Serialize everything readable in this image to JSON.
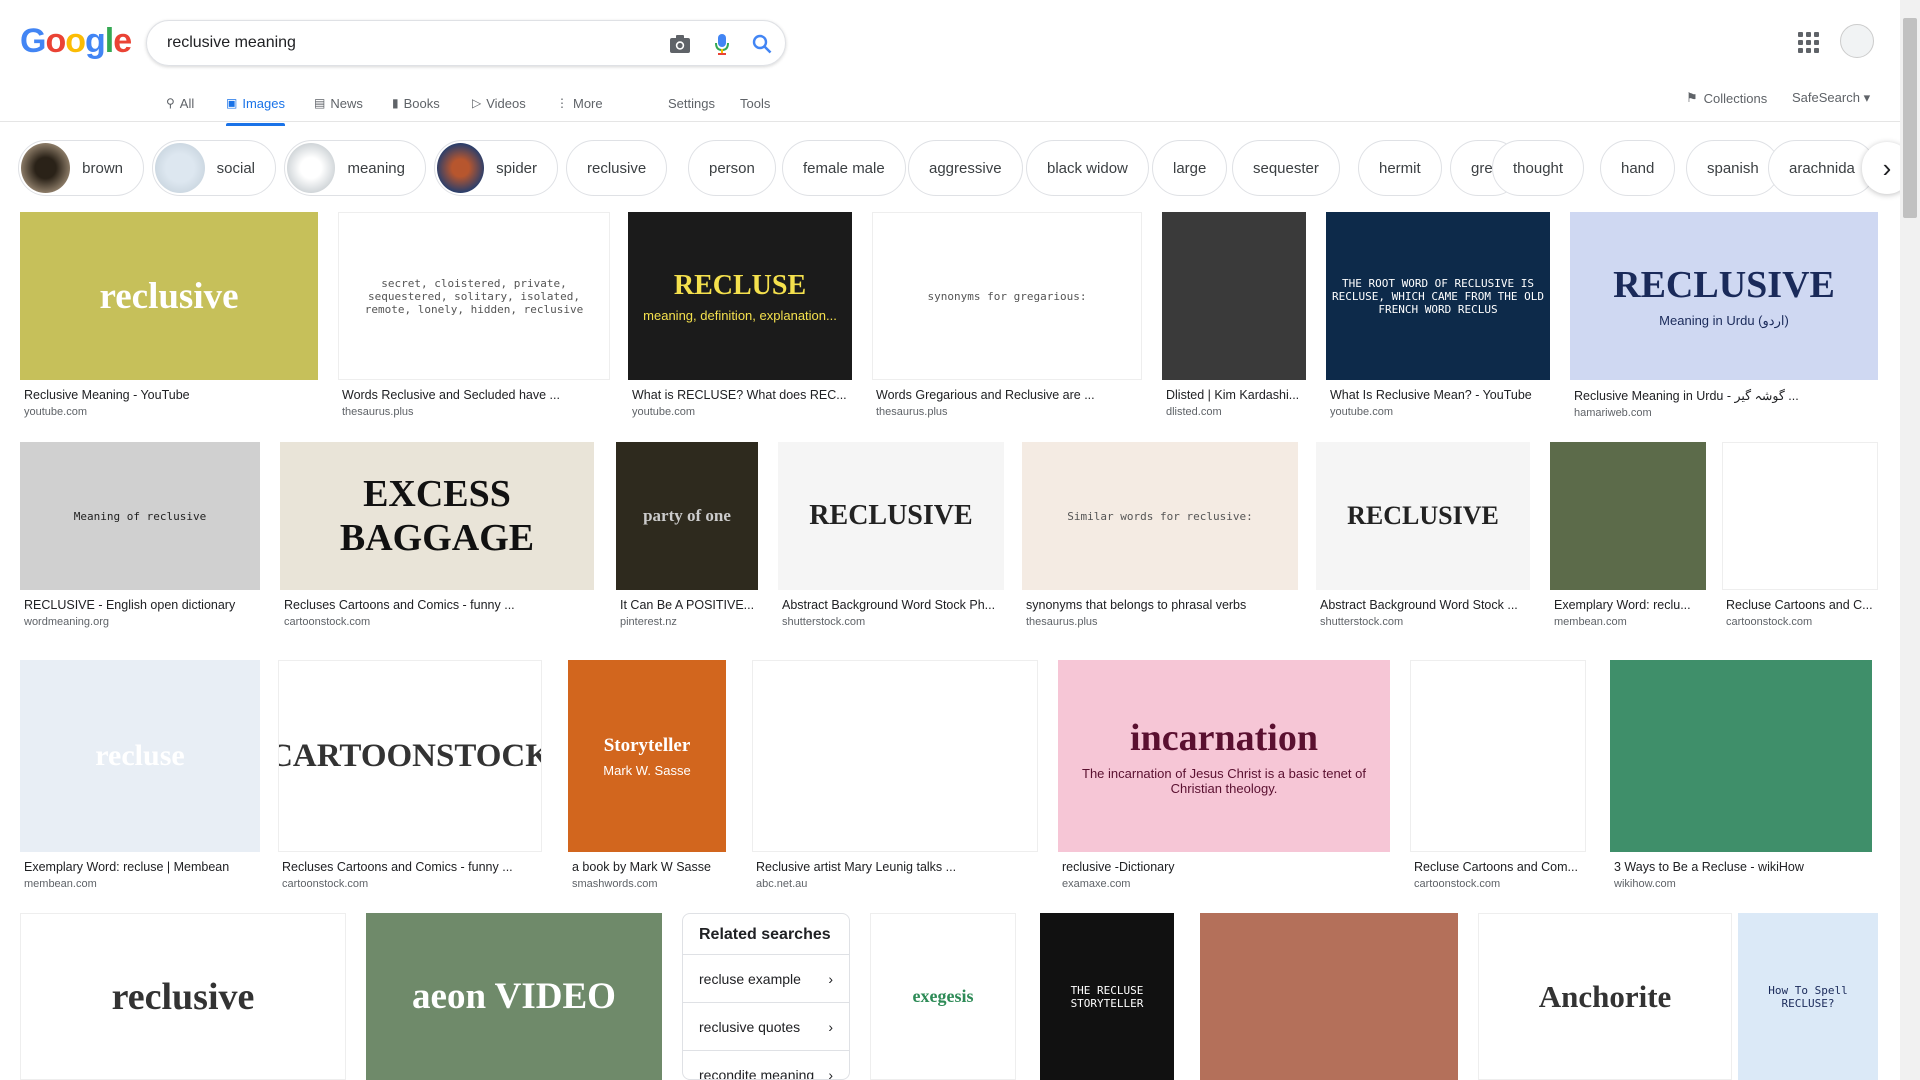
{
  "logo_text": [
    "G",
    "o",
    "o",
    "g",
    "l",
    "e"
  ],
  "search": {
    "value": "reclusive meaning"
  },
  "tabs": [
    {
      "label": "All",
      "icon": "search-icon"
    },
    {
      "label": "Images",
      "icon": "image-icon"
    },
    {
      "label": "News",
      "icon": "news-icon"
    },
    {
      "label": "Books",
      "icon": "book-icon"
    },
    {
      "label": "Videos",
      "icon": "video-icon"
    },
    {
      "label": "More",
      "icon": "more-vert-icon"
    },
    {
      "label": "Settings"
    },
    {
      "label": "Tools"
    }
  ],
  "collections_label": "Collections",
  "safesearch_label": "SafeSearch",
  "chips": [
    "brown",
    "social",
    "meaning",
    "spider",
    "reclusive",
    "person",
    "female male",
    "aggressive",
    "black widow",
    "large",
    "sequester",
    "hermit",
    "grey",
    "thought",
    "hand",
    "spanish",
    "arachnida"
  ],
  "results": [
    {
      "title": "Reclusive Meaning - YouTube",
      "domain": "youtube.com",
      "img_text": "reclusive",
      "bg": "#c6c05a",
      "fg": "#ffffff"
    },
    {
      "title": "Words Reclusive and Secluded have ...",
      "domain": "thesaurus.plus",
      "img_text": "secret, cloistered, private, sequestered, solitary, isolated, remote, lonely, hidden, reclusive",
      "bg": "#ffffff",
      "fg": "#555555"
    },
    {
      "title": "What is RECLUSE? What does REC...",
      "domain": "youtube.com",
      "img_text": "RECLUSE",
      "img_sub": "meaning, definition, explanation...",
      "bg": "#1b1b1b",
      "fg": "#f4e04d"
    },
    {
      "title": "Words Gregarious and Reclusive are ...",
      "domain": "thesaurus.plus",
      "img_text": "synonyms for gregarious:",
      "bg": "#ffffff",
      "fg": "#555555"
    },
    {
      "title": "Dlisted | Kim Kardashi...",
      "domain": "dlisted.com",
      "img_text": "",
      "bg": "#3a3a3a",
      "fg": "#ffffff"
    },
    {
      "title": "What Is Reclusive Mean? - YouTube",
      "domain": "youtube.com",
      "img_text": "THE ROOT WORD OF RECLUSIVE IS RECLUSE, WHICH CAME FROM THE OLD FRENCH WORD RECLUS",
      "bg": "#0d2a4a",
      "fg": "#ffffff"
    },
    {
      "title": "Reclusive Meaning in Urdu - گوشہ گیر ...",
      "domain": "hamariweb.com",
      "img_text": "RECLUSIVE",
      "img_sub": "Meaning in Urdu (اردو)",
      "bg": "#cfd8f2",
      "fg": "#1a2a5a"
    },
    {
      "title": "RECLUSIVE - English open dictionary",
      "domain": "wordmeaning.org",
      "img_text": "Meaning of reclusive",
      "bg": "#d0d0d0",
      "fg": "#222222"
    },
    {
      "title": "Recluses Cartoons and Comics - funny ...",
      "domain": "cartoonstock.com",
      "img_text": "EXCESS BAGGAGE",
      "bg": "#e9e4d8",
      "fg": "#111111"
    },
    {
      "title": "It Can Be A POSITIVE...",
      "domain": "pinterest.nz",
      "img_text": "party of one",
      "bg": "#2e2a1e",
      "fg": "#cccccc"
    },
    {
      "title": "Abstract Background Word Stock Ph...",
      "domain": "shutterstock.com",
      "img_text": "RECLUSIVE",
      "bg": "#f5f5f5",
      "fg": "#222222"
    },
    {
      "title": "synonyms that belongs to phrasal verbs",
      "domain": "thesaurus.plus",
      "img_text": "Similar words for reclusive:",
      "bg": "#f4ebe3",
      "fg": "#555555"
    },
    {
      "title": "Abstract Background Word Stock ...",
      "domain": "shutterstock.com",
      "img_text": "RECLUSIVE",
      "bg": "#f5f5f5",
      "fg": "#222222"
    },
    {
      "title": "Exemplary Word: reclu...",
      "domain": "membean.com",
      "img_text": "",
      "bg": "#5c6b4a",
      "fg": "#ffffff"
    },
    {
      "title": "Recluse Cartoons and C...",
      "domain": "cartoonstock.com",
      "img_text": "",
      "bg": "#ffffff",
      "fg": "#333333"
    },
    {
      "title": "Exemplary Word: recluse | Membean",
      "domain": "membean.com",
      "img_text": "recluse",
      "bg": "#e8eef5",
      "fg": "#ffffff"
    },
    {
      "title": "Recluses Cartoons and Comics - funny ...",
      "domain": "cartoonstock.com",
      "img_text": "CARTOONSTOCK",
      "bg": "#ffffff",
      "fg": "#333333"
    },
    {
      "title": "a book by Mark W Sasse",
      "domain": "smashwords.com",
      "img_text": "Storyteller",
      "img_sub": "Mark W. Sasse",
      "bg": "#d2661e",
      "fg": "#ffffff"
    },
    {
      "title": "Reclusive artist Mary Leunig talks ...",
      "domain": "abc.net.au",
      "img_text": "",
      "bg": "#ffffff",
      "fg": "#333333"
    },
    {
      "title": "reclusive -Dictionary",
      "domain": "examaxe.com",
      "img_text": "incarnation",
      "img_sub": "The incarnation of Jesus Christ is a basic tenet of Christian theology.",
      "bg": "#f6c6d6",
      "fg": "#5a1030"
    },
    {
      "title": "Recluse Cartoons and Com...",
      "domain": "cartoonstock.com",
      "img_text": "",
      "bg": "#ffffff",
      "fg": "#333333"
    },
    {
      "title": "3 Ways to Be a Recluse - wikiHow",
      "domain": "wikihow.com",
      "img_text": "",
      "bg": "#3f8f6a",
      "fg": "#ffffff"
    },
    {
      "title": "",
      "domain": "",
      "img_text": "reclusive",
      "bg": "#ffffff",
      "fg": "#333333"
    },
    {
      "title": "",
      "domain": "",
      "img_text": "aeon VIDEO",
      "bg": "#6f8a6a",
      "fg": "#ffffff"
    },
    {
      "title": "",
      "domain": "",
      "img_text": "exegesis",
      "bg": "#ffffff",
      "fg": "#2e8b57"
    },
    {
      "title": "",
      "domain": "",
      "img_text": "THE RECLUSE STORYTELLER",
      "bg": "#111111",
      "fg": "#ffffff"
    },
    {
      "title": "",
      "domain": "",
      "img_text": "",
      "bg": "#b4705a",
      "fg": "#ffffff"
    },
    {
      "title": "",
      "domain": "",
      "img_text": "Anchorite",
      "bg": "#ffffff",
      "fg": "#333333"
    },
    {
      "title": "",
      "domain": "",
      "img_text": "How To Spell RECLUSE?",
      "bg": "#dbe9f7",
      "fg": "#1a2a5a"
    }
  ],
  "related": {
    "heading": "Related searches",
    "items": [
      "recluse example",
      "reclusive quotes",
      "recondite meaning"
    ]
  }
}
